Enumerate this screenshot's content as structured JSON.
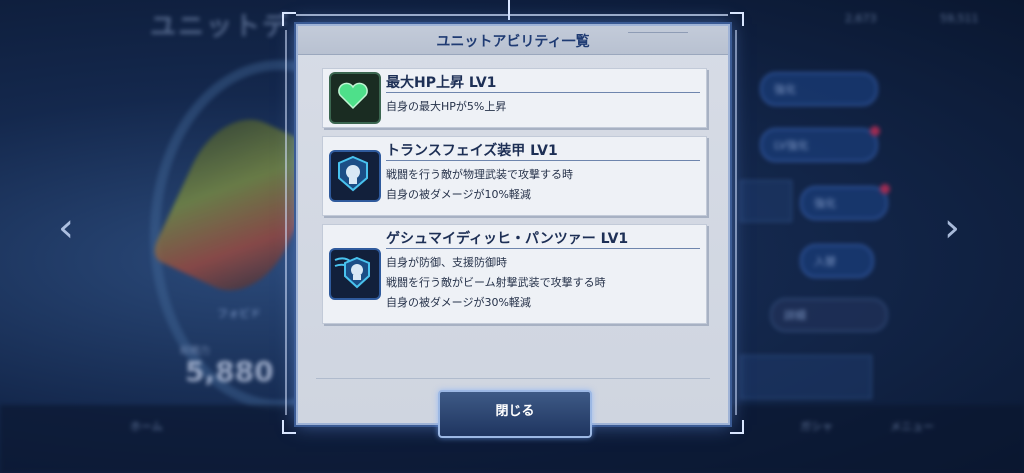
{
  "background": {
    "screen_title": "ユニットデ",
    "stat_label": "総戦力",
    "stat_value": "5,880",
    "pilot_name": "フォビド",
    "side_buttons": [
      {
        "label": "強化"
      },
      {
        "label": "LV強化"
      },
      {
        "label": "強化"
      },
      {
        "label": "入替"
      },
      {
        "label": "詳細"
      }
    ],
    "bottom_nav": [
      {
        "label": "ホーム"
      },
      {
        "label": "ガシャ"
      },
      {
        "label": "メニュー"
      }
    ],
    "top_right": [
      "2,673",
      "59,511"
    ]
  },
  "modal": {
    "title": "ユニットアビリティ一覧",
    "abilities": [
      {
        "name": "最大HP上昇 LV1",
        "icon": "heart-icon",
        "lines": [
          "自身の最大HPが5%上昇"
        ]
      },
      {
        "name": "トランスフェイズ装甲 LV1",
        "icon": "armor-shield-icon",
        "lines": [
          "戦闘を行う敵が物理武装で攻撃する時",
          "自身の被ダメージが10%軽減"
        ]
      },
      {
        "name": "ゲシュマイディッヒ・パンツァー LV1",
        "icon": "beam-deflect-shield-icon",
        "lines": [
          "自身が防御、支援防御時",
          "戦闘を行う敵がビーム射撃武装で攻撃する時",
          "自身の被ダメージが30%軽減"
        ]
      }
    ],
    "close_label": "閉じる"
  },
  "colors": {
    "accent": "#1f3b73",
    "heart": "#4ee08a",
    "shield": "#49c2ee",
    "notification": "#e0315a"
  }
}
